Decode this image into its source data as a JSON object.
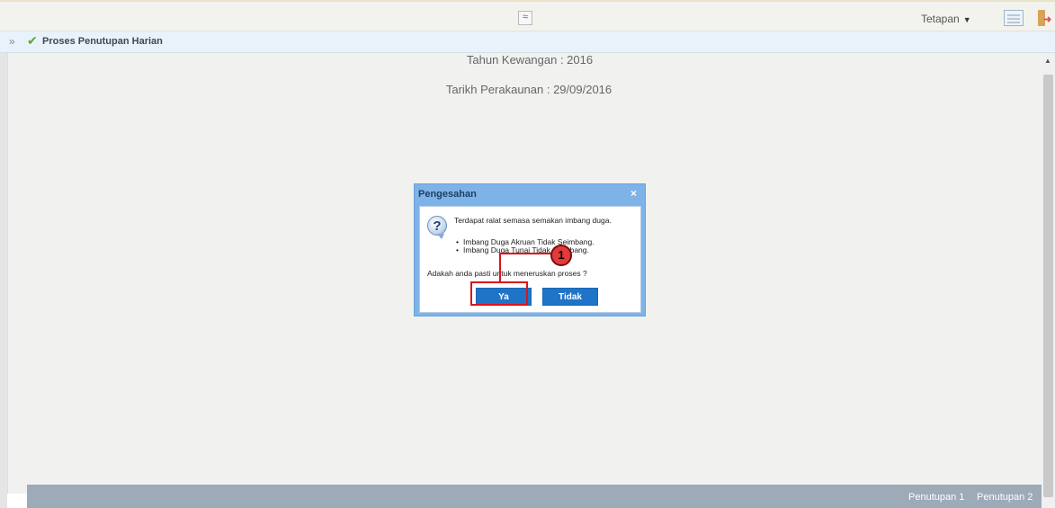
{
  "toolbar": {
    "collapse_glyph": "≈",
    "settings_label": "Tetapan",
    "settings_caret": "▼"
  },
  "tab": {
    "expand_glyph": "»",
    "check_glyph": "✔",
    "title": "Proses Penutupan Harian"
  },
  "main": {
    "year_line": "Tahun Kewangan : 2016",
    "date_line": "Tarikh Perakaunan : 29/09/2016"
  },
  "dialog": {
    "title": "Pengesahan",
    "close": "×",
    "icon": "question-icon",
    "icon_glyph": "?",
    "message": "Terdapat ralat semasa semakan imbang duga.",
    "items": [
      "Imbang Duga Akruan Tidak Seimbang.",
      "Imbang Duga Tunai Tidak Seimbang."
    ],
    "question": "Adakah anda pasti untuk meneruskan proses ?",
    "confirm_label": "Ya",
    "cancel_label": "Tidak"
  },
  "annotation": {
    "step": "1",
    "color": "#d9141c"
  },
  "bottom_tabs": [
    "Penutupan 1",
    "Penutupan 2"
  ],
  "colors": {
    "primary_button": "#1f74c8",
    "dialog_frame": "#7eb3e8",
    "bottom_bar": "#9daab7"
  }
}
